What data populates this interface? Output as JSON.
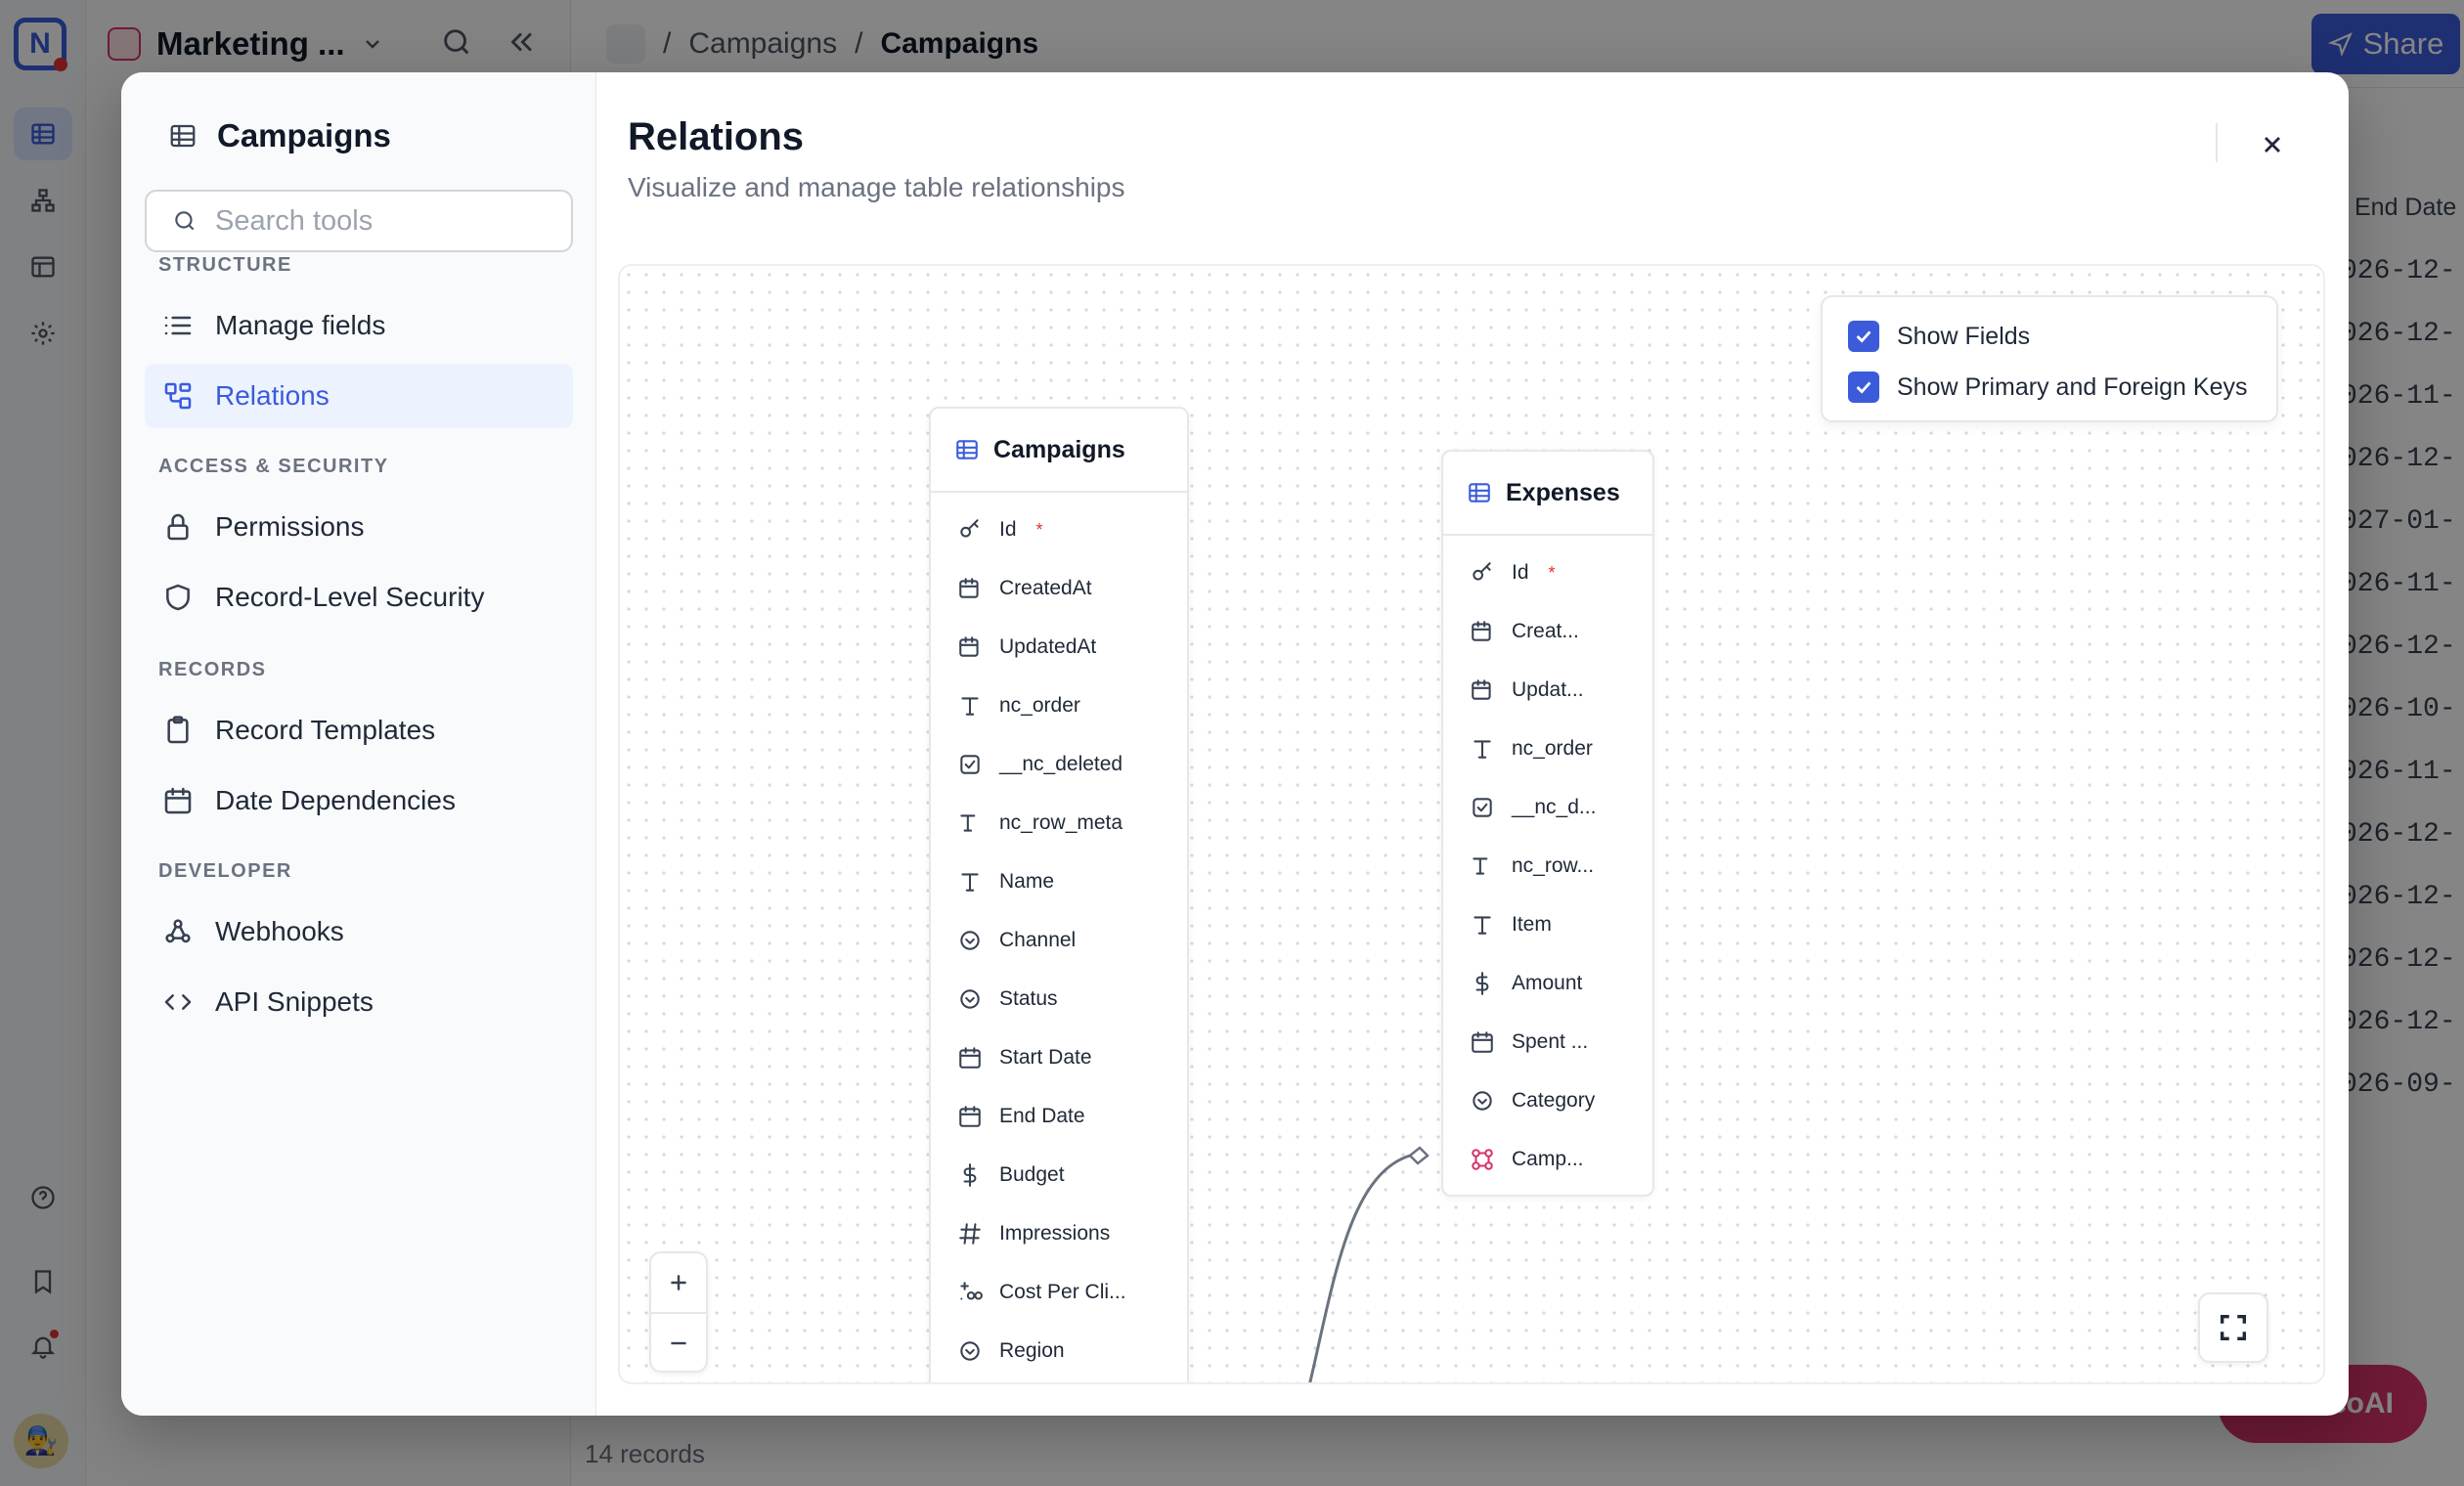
{
  "background": {
    "workspace_title": "Marketing ...",
    "breadcrumb": [
      "Campaigns",
      "Campaigns"
    ],
    "share_label": "Share",
    "column_header": "End Date",
    "date_cells": [
      "026-12-",
      "026-12-",
      "026-11-",
      "026-12-",
      "027-01-",
      "026-11-",
      "026-12-",
      "026-10-",
      "026-11-",
      "026-12-",
      "026-12-",
      "026-12-",
      "026-12-",
      "026-09-"
    ],
    "records_count": "14 records",
    "ai_button_label": "coAI"
  },
  "modal": {
    "sidebar": {
      "title": "Campaigns",
      "search_placeholder": "Search tools",
      "sections": [
        {
          "label": "STRUCTURE",
          "items": [
            {
              "label": "Manage fields",
              "icon": "list-icon"
            },
            {
              "label": "Relations",
              "icon": "relations-icon",
              "active": true
            }
          ]
        },
        {
          "label": "ACCESS & SECURITY",
          "items": [
            {
              "label": "Permissions",
              "icon": "lock-icon"
            },
            {
              "label": "Record-Level Security",
              "icon": "shield-icon"
            }
          ]
        },
        {
          "label": "RECORDS",
          "items": [
            {
              "label": "Record Templates",
              "icon": "clipboard-icon"
            },
            {
              "label": "Date Dependencies",
              "icon": "calendar-icon"
            }
          ]
        },
        {
          "label": "DEVELOPER",
          "items": [
            {
              "label": "Webhooks",
              "icon": "webhook-icon"
            },
            {
              "label": "API Snippets",
              "icon": "code-icon"
            }
          ]
        }
      ]
    },
    "title": "Relations",
    "subtitle": "Visualize and manage table relationships",
    "legend": {
      "show_fields": {
        "label": "Show Fields",
        "checked": true
      },
      "show_keys": {
        "label": "Show Primary and Foreign Keys",
        "checked": true
      }
    },
    "tables": [
      {
        "name": "Campaigns",
        "fields": [
          {
            "name": "Id",
            "type": "key",
            "required": true
          },
          {
            "name": "CreatedAt",
            "type": "datetime-sys"
          },
          {
            "name": "UpdatedAt",
            "type": "datetime-sys"
          },
          {
            "name": "nc_order",
            "type": "text"
          },
          {
            "name": "__nc_deleted",
            "type": "checkbox"
          },
          {
            "name": "nc_row_meta",
            "type": "text-sys"
          },
          {
            "name": "Name",
            "type": "text"
          },
          {
            "name": "Channel",
            "type": "select"
          },
          {
            "name": "Status",
            "type": "select"
          },
          {
            "name": "Start Date",
            "type": "date"
          },
          {
            "name": "End Date",
            "type": "date"
          },
          {
            "name": "Budget",
            "type": "currency"
          },
          {
            "name": "Impressions",
            "type": "number"
          },
          {
            "name": "Cost Per Cli...",
            "type": "decimal"
          },
          {
            "name": "Region",
            "type": "select"
          }
        ]
      },
      {
        "name": "Expenses",
        "fields": [
          {
            "name": "Id",
            "type": "key",
            "required": true
          },
          {
            "name": "Creat...",
            "type": "datetime-sys"
          },
          {
            "name": "Updat...",
            "type": "datetime-sys"
          },
          {
            "name": "nc_order",
            "type": "text"
          },
          {
            "name": "__nc_d...",
            "type": "checkbox"
          },
          {
            "name": "nc_row...",
            "type": "text-sys"
          },
          {
            "name": "Item",
            "type": "text"
          },
          {
            "name": "Amount",
            "type": "currency"
          },
          {
            "name": "Spent ...",
            "type": "date"
          },
          {
            "name": "Category",
            "type": "select"
          },
          {
            "name": "Camp...",
            "type": "link"
          }
        ]
      }
    ],
    "colors": {
      "accent": "#3b5bdb",
      "required": "#e03131",
      "link": "#d6336c"
    }
  }
}
